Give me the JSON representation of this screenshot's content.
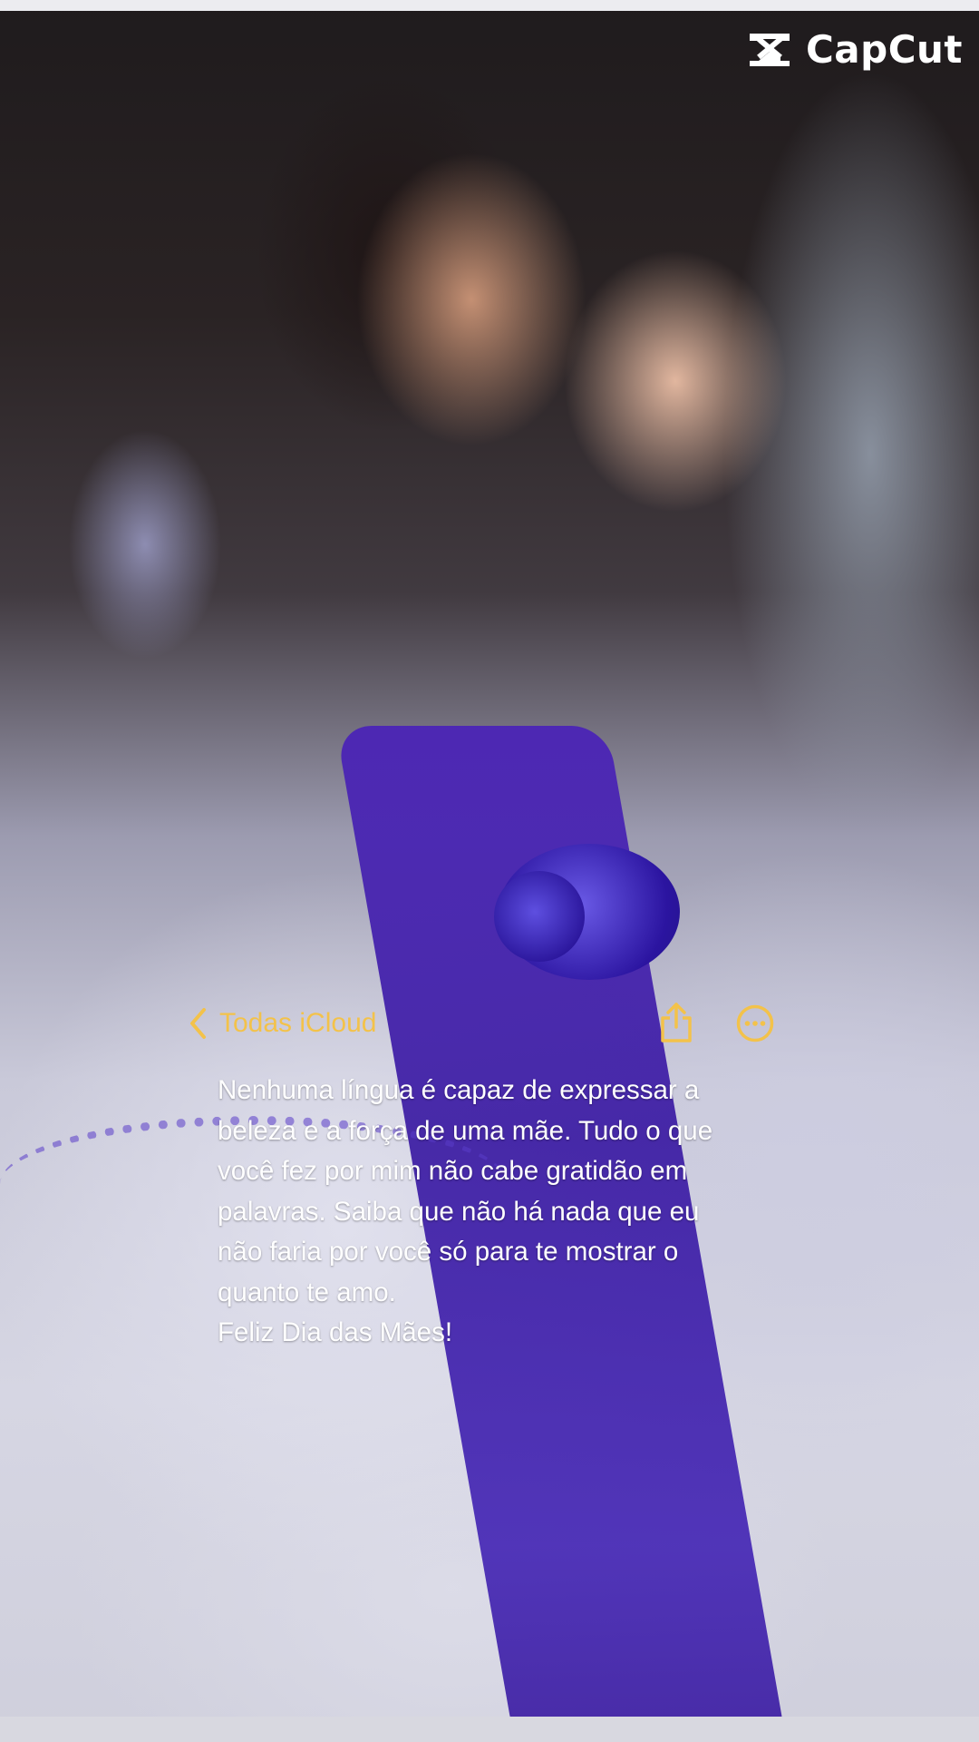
{
  "watermark": {
    "brand": "CapCut",
    "icon": "capcut-logo-icon"
  },
  "notes": {
    "back_label": "Todas iCloud",
    "back_icon": "chevron-left-icon",
    "share_icon": "share-icon",
    "more_icon": "ellipsis-circle-icon",
    "accent_color": "#f3c24a",
    "lines": [
      "Nenhuma língua é capaz de expressar a",
      "beleza e a força de uma mãe. Tudo o que",
      "você fez por mim não cabe gratidão em",
      "palavras. Saiba que não há nada que eu",
      "não faria por você só para te mostrar o",
      "quanto te amo.",
      "Feliz Dia das Mães!"
    ]
  }
}
